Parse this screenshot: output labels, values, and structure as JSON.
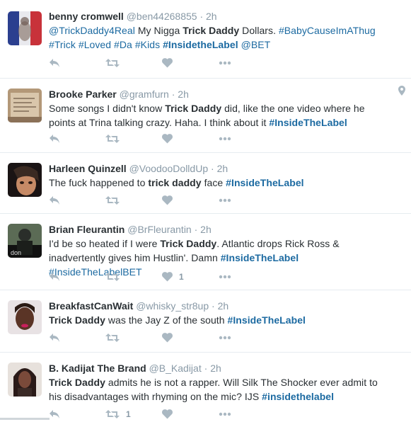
{
  "tweets": [
    {
      "name": "benny cromwell",
      "handle": "@ben44268855",
      "time": "2h",
      "text": [
        {
          "t": "@TrickDaddy4Real",
          "s": "tag"
        },
        {
          "t": " My Nigga "
        },
        {
          "t": "Trick Daddy",
          "s": "b"
        },
        {
          "t": " Dollars. "
        },
        {
          "t": "#BabyCauseImAThug",
          "s": "tag"
        },
        {
          "t": " "
        },
        {
          "t": "#Trick",
          "s": "tag"
        },
        {
          "t": " "
        },
        {
          "t": "#Loved",
          "s": "tag"
        },
        {
          "t": " "
        },
        {
          "t": "#Da",
          "s": "tag"
        },
        {
          "t": " "
        },
        {
          "t": "#Kids",
          "s": "tag"
        },
        {
          "t": " "
        },
        {
          "t": "#InsidetheLabel",
          "s": "tagb"
        },
        {
          "t": " "
        },
        {
          "t": "@BET",
          "s": "tag"
        }
      ],
      "avatar": {
        "colors": [
          "#2b3f8f",
          "#c8323a",
          "#e9e9ee"
        ]
      },
      "likes": "",
      "retweets": ""
    },
    {
      "name": "Brooke Parker",
      "handle": "@gramfurn",
      "time": "2h",
      "text": [
        {
          "t": "Some songs I didn't know "
        },
        {
          "t": "Trick Daddy",
          "s": "b"
        },
        {
          "t": " did, like the one video where he points at Trina talking crazy. Haha. I think about it "
        },
        {
          "t": "#InsideTheLabel",
          "s": "tagb"
        }
      ],
      "avatar": {
        "colors": [
          "#b39878",
          "#8b7158",
          "#d9c6ab"
        ]
      },
      "likes": "",
      "retweets": "",
      "geo": true
    },
    {
      "name": "Harleen Quinzell",
      "handle": "@VoodooDolldUp",
      "time": "2h",
      "text": [
        {
          "t": "The fuck happened to "
        },
        {
          "t": "trick daddy",
          "s": "b"
        },
        {
          "t": " face "
        },
        {
          "t": "#InsideTheLabel",
          "s": "tagb"
        }
      ],
      "avatar": {
        "colors": [
          "#1a1414",
          "#c68a66",
          "#3a2a22"
        ]
      },
      "likes": "",
      "retweets": ""
    },
    {
      "name": "Brian Fleurantin",
      "handle": "@BrFleurantin",
      "time": "2h",
      "text": [
        {
          "t": "I'd be so heated if I were "
        },
        {
          "t": "Trick Daddy",
          "s": "b"
        },
        {
          "t": ". Atlantic drops Rick Ross & inadvertently gives him Hustlin'. Damn "
        },
        {
          "t": "#InsideTheLabel",
          "s": "tagb"
        },
        {
          "t": " "
        },
        {
          "t": "#InsideTheLabelBET",
          "s": "tag"
        }
      ],
      "avatar": {
        "colors": [
          "#2a2e2a",
          "#5b6b55",
          "#111111"
        ]
      },
      "likes": "1",
      "retweets": ""
    },
    {
      "name": "BreakfastCanWait",
      "handle": "@whisky_str8up",
      "time": "2h",
      "text": [
        {
          "t": "Trick Daddy",
          "s": "b"
        },
        {
          "t": " was the Jay Z of the south "
        },
        {
          "t": "#InsideTheLabel",
          "s": "tagb"
        }
      ],
      "avatar": {
        "colors": [
          "#e8e2e4",
          "#5a3426",
          "#c91f5c"
        ]
      },
      "likes": "",
      "retweets": ""
    },
    {
      "name": "B. Kadijat The Brand",
      "handle": "@B_Kadijat",
      "time": "2h",
      "text": [
        {
          "t": "Trick Daddy",
          "s": "b"
        },
        {
          "t": " admits he is not a rapper. Will Silk The Shocker ever admit to his disadvantages with rhyming on the mic? IJS "
        },
        {
          "t": "#insidethelabel",
          "s": "tagb"
        }
      ],
      "avatar": {
        "colors": [
          "#2a1a18",
          "#7a4a3a",
          "#e7e1dc"
        ]
      },
      "likes": "",
      "retweets": "1"
    }
  ],
  "icons": {
    "reply": "reply-icon",
    "retweet": "retweet-icon",
    "like": "heart-icon",
    "more": "more-icon",
    "geo": "location-pin-icon"
  },
  "colors": {
    "link": "#1c6aa1",
    "muted": "#8899a6",
    "icon": "#aab8c2",
    "name": "#292f33"
  }
}
